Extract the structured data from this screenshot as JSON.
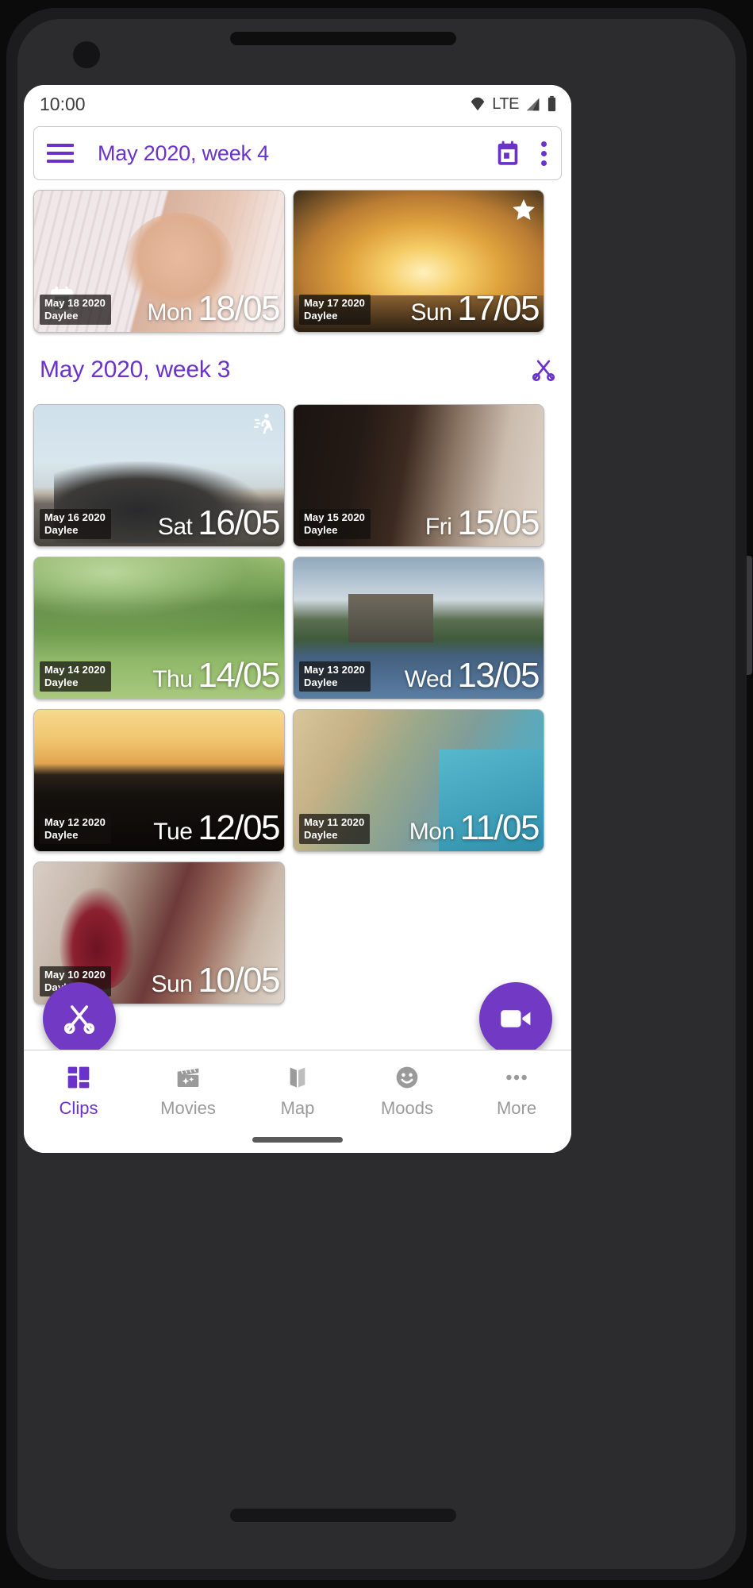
{
  "status_bar": {
    "time": "10:00",
    "network_label": "LTE",
    "icons": [
      "wifi-icon",
      "signal-icon",
      "battery-icon"
    ]
  },
  "toolbar": {
    "menu_icon": "hamburger-menu-icon",
    "title": "May 2020, week 4",
    "calendar_icon": "calendar-icon",
    "overflow_icon": "overflow-menu-icon"
  },
  "theme": {
    "accent": "#6b32c9",
    "fab": "#7239c4",
    "inactive": "#9a9a9a"
  },
  "sections": [
    {
      "id": "week4",
      "header_in_toolbar": true,
      "cards": [
        {
          "date_label": "May 18 2020",
          "author": "Daylee",
          "day_of_week": "Mon",
          "day_month": "18/05",
          "photo": "p-baby",
          "badge": "calendar-badge-icon",
          "badge_position": "bottom-left"
        },
        {
          "date_label": "May 17 2020",
          "author": "Daylee",
          "day_of_week": "Sun",
          "day_month": "17/05",
          "photo": "p-sunset-dad",
          "badge": "star-badge-icon",
          "badge_position": "top-right"
        }
      ]
    },
    {
      "id": "week3",
      "title": "May 2020, week 3",
      "scissors_icon": "scissors-icon",
      "cards": [
        {
          "date_label": "May 16 2020",
          "author": "Daylee",
          "day_of_week": "Sat",
          "day_month": "16/05",
          "photo": "p-moto",
          "badge": "running-badge-icon",
          "badge_position": "top-right"
        },
        {
          "date_label": "May 15 2020",
          "author": "Daylee",
          "day_of_week": "Fri",
          "day_month": "15/05",
          "photo": "p-friends",
          "badge": null,
          "badge_position": null
        },
        {
          "date_label": "May 14 2020",
          "author": "Daylee",
          "day_of_week": "Thu",
          "day_month": "14/05",
          "photo": "p-field",
          "badge": null,
          "badge_position": null
        },
        {
          "date_label": "May 13 2020",
          "author": "Daylee",
          "day_of_week": "Wed",
          "day_month": "13/05",
          "photo": "p-castle",
          "badge": null,
          "badge_position": null
        },
        {
          "date_label": "May 12 2020",
          "author": "Daylee",
          "day_of_week": "Tue",
          "day_month": "12/05",
          "photo": "p-jump",
          "badge": null,
          "badge_position": null
        },
        {
          "date_label": "May 11 2020",
          "author": "Daylee",
          "day_of_week": "Mon",
          "day_month": "11/05",
          "photo": "p-pool",
          "badge": null,
          "badge_position": null
        },
        {
          "date_label": "May 10 2020",
          "author": "Daylee",
          "day_of_week": "Sun",
          "day_month": "10/05",
          "photo": "p-wine",
          "badge": null,
          "badge_position": null
        }
      ]
    }
  ],
  "fabs": {
    "cut": {
      "icon": "scissors-icon",
      "label": "Cut"
    },
    "video": {
      "icon": "video-camera-icon",
      "label": "Record"
    }
  },
  "bottom_nav": {
    "items": [
      {
        "label": "Clips",
        "icon": "grid-icon",
        "active": true
      },
      {
        "label": "Movies",
        "icon": "clapperboard-icon",
        "active": false
      },
      {
        "label": "Map",
        "icon": "map-icon",
        "active": false
      },
      {
        "label": "Moods",
        "icon": "smiley-icon",
        "active": false
      },
      {
        "label": "More",
        "icon": "more-dots-icon",
        "active": false
      }
    ]
  }
}
